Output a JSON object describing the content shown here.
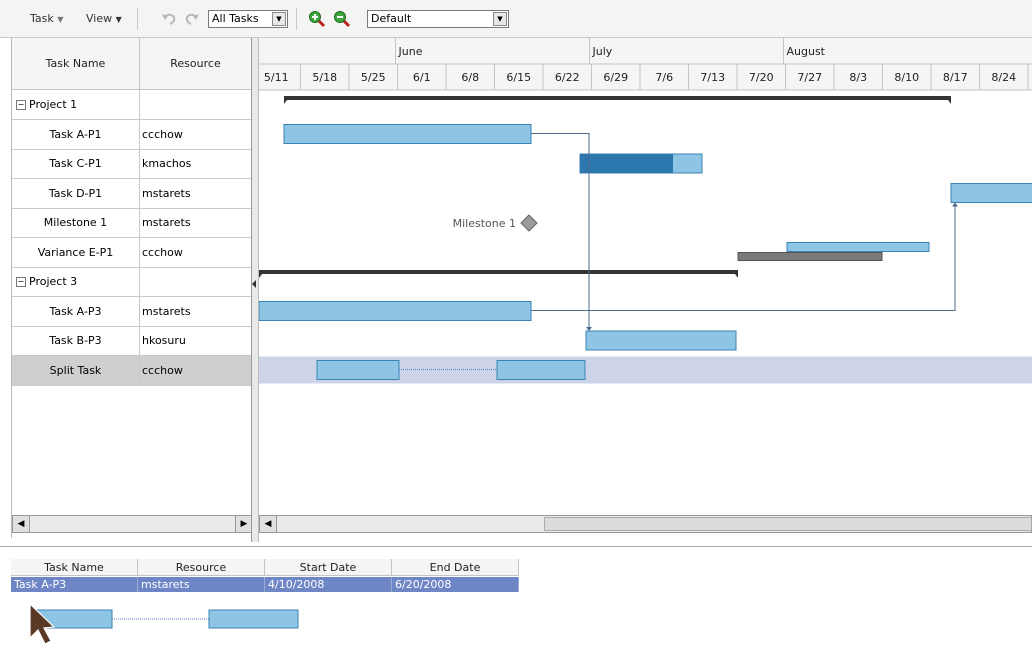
{
  "toolbar": {
    "task_menu": "Task",
    "view_menu": "View",
    "filter_select": "All Tasks",
    "view_select": "Default"
  },
  "left": {
    "headers": [
      "Task Name",
      "Resource"
    ],
    "rows": [
      {
        "name": "Project 1",
        "resource": "",
        "group": true
      },
      {
        "name": "Task A-P1",
        "resource": "ccchow"
      },
      {
        "name": "Task C-P1",
        "resource": "kmachos"
      },
      {
        "name": "Task D-P1",
        "resource": "mstarets"
      },
      {
        "name": "Milestone 1",
        "resource": "mstarets"
      },
      {
        "name": "Variance E-P1",
        "resource": "ccchow"
      },
      {
        "name": "Project 3",
        "resource": "",
        "group": true
      },
      {
        "name": "Task A-P3",
        "resource": "mstarets"
      },
      {
        "name": "Task B-P3",
        "resource": "hkosuru"
      },
      {
        "name": "Split Task",
        "resource": "ccchow",
        "selected": true
      }
    ]
  },
  "timeline": {
    "months": [
      "June",
      "July",
      "August"
    ],
    "weeks": [
      "5/11",
      "5/18",
      "5/25",
      "6/1",
      "6/8",
      "6/15",
      "6/22",
      "6/29",
      "7/6",
      "7/13",
      "7/20",
      "7/27",
      "8/3",
      "8/10",
      "8/17",
      "8/24"
    ]
  },
  "gantt": {
    "milestone_label": "Milestone 1"
  },
  "detail": {
    "headers": [
      "Task Name",
      "Resource",
      "Start Date",
      "End Date"
    ],
    "row": [
      "Task A-P3",
      "mstarets",
      "4/10/2008",
      "6/20/2008"
    ]
  },
  "colors": {
    "bar_fill": "#8ec4e4",
    "bar_border": "#3a83b3",
    "progress_fill": "#2c77ad",
    "summary": "#333333",
    "variance": "#7a7a7a",
    "selection_row": "#cdd4e8",
    "detail_selection": "#6e86c6"
  }
}
